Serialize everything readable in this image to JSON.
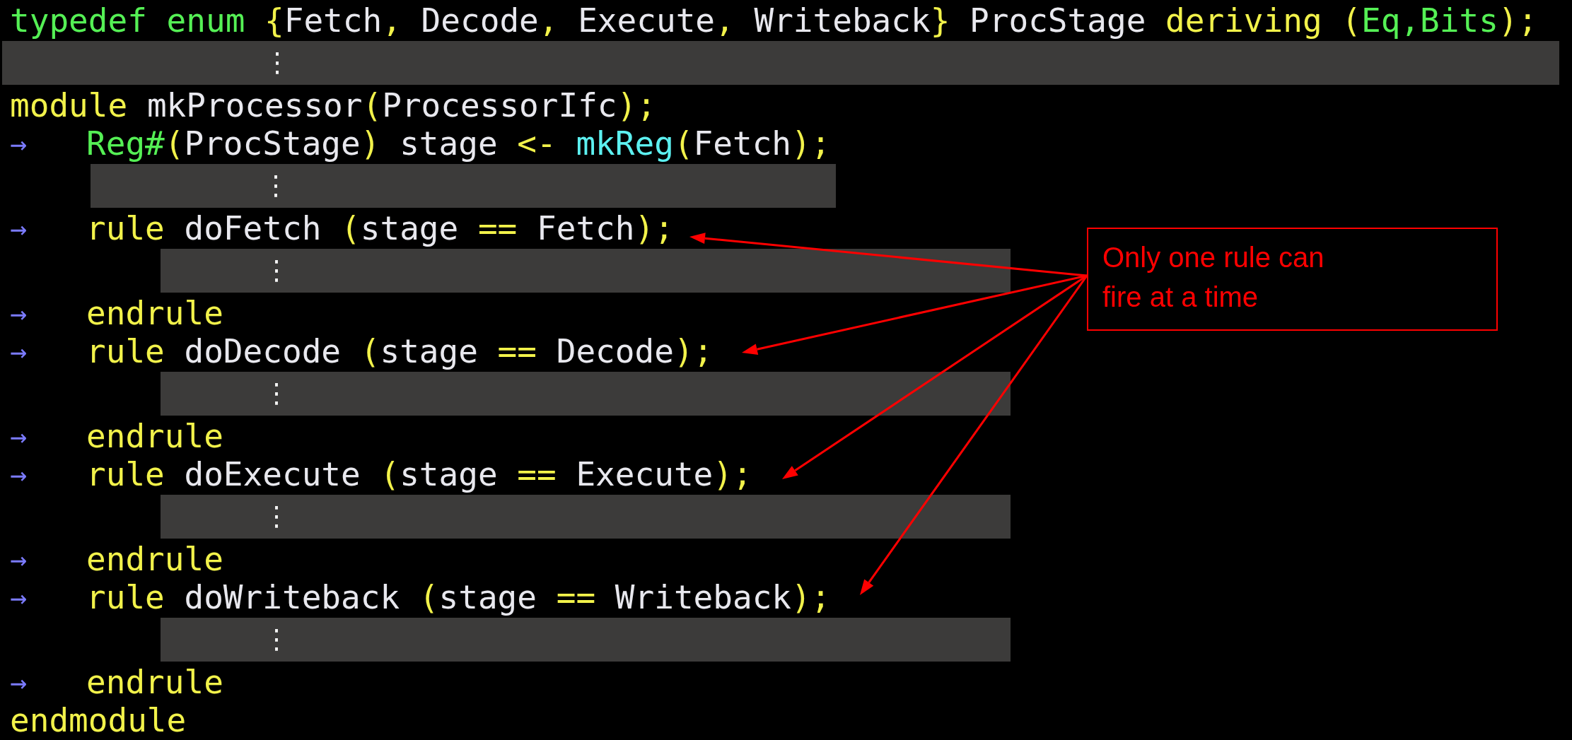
{
  "lines": [
    {
      "kind": "code",
      "tokens": [
        {
          "text": "typedef enum ",
          "kind": "type"
        },
        {
          "text": "{",
          "kind": "punct"
        },
        {
          "text": "Fetch",
          "kind": "plain"
        },
        {
          "text": ", ",
          "kind": "punct"
        },
        {
          "text": "Decode",
          "kind": "plain"
        },
        {
          "text": ", ",
          "kind": "punct"
        },
        {
          "text": "Execute",
          "kind": "plain"
        },
        {
          "text": ", ",
          "kind": "punct"
        },
        {
          "text": "Writeback",
          "kind": "plain"
        },
        {
          "text": "}",
          "kind": "punct"
        },
        {
          "text": " ProcStage ",
          "kind": "plain"
        },
        {
          "text": "deriving ",
          "kind": "keyword"
        },
        {
          "text": "(",
          "kind": "punct"
        },
        {
          "text": "Eq,Bits",
          "kind": "type"
        },
        {
          "text": ");",
          "kind": "punct"
        }
      ]
    },
    {
      "kind": "gap",
      "mark": "⋮"
    },
    {
      "kind": "code",
      "tokens": [
        {
          "text": "module ",
          "kind": "keyword"
        },
        {
          "text": "mkProcessor",
          "kind": "plain"
        },
        {
          "text": "(",
          "kind": "punct"
        },
        {
          "text": "ProcessorIfc",
          "kind": "plain"
        },
        {
          "text": ");",
          "kind": "punct"
        }
      ]
    },
    {
      "kind": "code",
      "marker": "→",
      "tokens": [
        {
          "text": "Reg#",
          "kind": "type"
        },
        {
          "text": "(",
          "kind": "punct"
        },
        {
          "text": "ProcStage",
          "kind": "plain"
        },
        {
          "text": ") ",
          "kind": "punct"
        },
        {
          "text": "stage ",
          "kind": "plain"
        },
        {
          "text": "<- ",
          "kind": "keyword"
        },
        {
          "text": "mkReg",
          "kind": "func"
        },
        {
          "text": "(",
          "kind": "punct"
        },
        {
          "text": "Fetch",
          "kind": "plain"
        },
        {
          "text": ");",
          "kind": "punct"
        }
      ]
    },
    {
      "kind": "gap",
      "mark": "⋮"
    },
    {
      "kind": "code",
      "marker": "→",
      "tokens": [
        {
          "text": "rule ",
          "kind": "keyword"
        },
        {
          "text": "doFetch ",
          "kind": "plain"
        },
        {
          "text": "(",
          "kind": "punct"
        },
        {
          "text": "stage ",
          "kind": "plain"
        },
        {
          "text": "== ",
          "kind": "keyword"
        },
        {
          "text": "Fetch",
          "kind": "plain"
        },
        {
          "text": ");",
          "kind": "punct"
        }
      ]
    },
    {
      "kind": "gap",
      "mark": "⋮"
    },
    {
      "kind": "code",
      "marker": "→",
      "tokens": [
        {
          "text": "endrule",
          "kind": "keyword"
        }
      ]
    },
    {
      "kind": "code",
      "marker": "→",
      "tokens": [
        {
          "text": "rule ",
          "kind": "keyword"
        },
        {
          "text": "doDecode ",
          "kind": "plain"
        },
        {
          "text": "(",
          "kind": "punct"
        },
        {
          "text": "stage ",
          "kind": "plain"
        },
        {
          "text": "== ",
          "kind": "keyword"
        },
        {
          "text": "Decode",
          "kind": "plain"
        },
        {
          "text": ");",
          "kind": "punct"
        }
      ]
    },
    {
      "kind": "gap",
      "mark": "⋮"
    },
    {
      "kind": "code",
      "marker": "→",
      "tokens": [
        {
          "text": "endrule",
          "kind": "keyword"
        }
      ]
    },
    {
      "kind": "code",
      "marker": "→",
      "tokens": [
        {
          "text": "rule ",
          "kind": "keyword"
        },
        {
          "text": "doExecute ",
          "kind": "plain"
        },
        {
          "text": "(",
          "kind": "punct"
        },
        {
          "text": "stage ",
          "kind": "plain"
        },
        {
          "text": "== ",
          "kind": "keyword"
        },
        {
          "text": "Execute",
          "kind": "plain"
        },
        {
          "text": ");",
          "kind": "punct"
        }
      ]
    },
    {
      "kind": "gap",
      "mark": "⋮"
    },
    {
      "kind": "code",
      "marker": "→",
      "tokens": [
        {
          "text": "endrule",
          "kind": "keyword"
        }
      ]
    },
    {
      "kind": "code",
      "marker": "→",
      "tokens": [
        {
          "text": "rule ",
          "kind": "keyword"
        },
        {
          "text": "doWriteback ",
          "kind": "plain"
        },
        {
          "text": "(",
          "kind": "punct"
        },
        {
          "text": "stage ",
          "kind": "plain"
        },
        {
          "text": "== ",
          "kind": "keyword"
        },
        {
          "text": "Writeback",
          "kind": "plain"
        },
        {
          "text": ");",
          "kind": "punct"
        }
      ]
    },
    {
      "kind": "gap",
      "mark": "⋮"
    },
    {
      "kind": "code",
      "marker": "→",
      "tokens": [
        {
          "text": "endrule",
          "kind": "keyword"
        }
      ]
    },
    {
      "kind": "code",
      "tokens": [
        {
          "text": "endmodule",
          "kind": "keyword"
        }
      ]
    }
  ],
  "callout": {
    "lines": [
      "Only one rule can",
      "fire at a time"
    ]
  }
}
